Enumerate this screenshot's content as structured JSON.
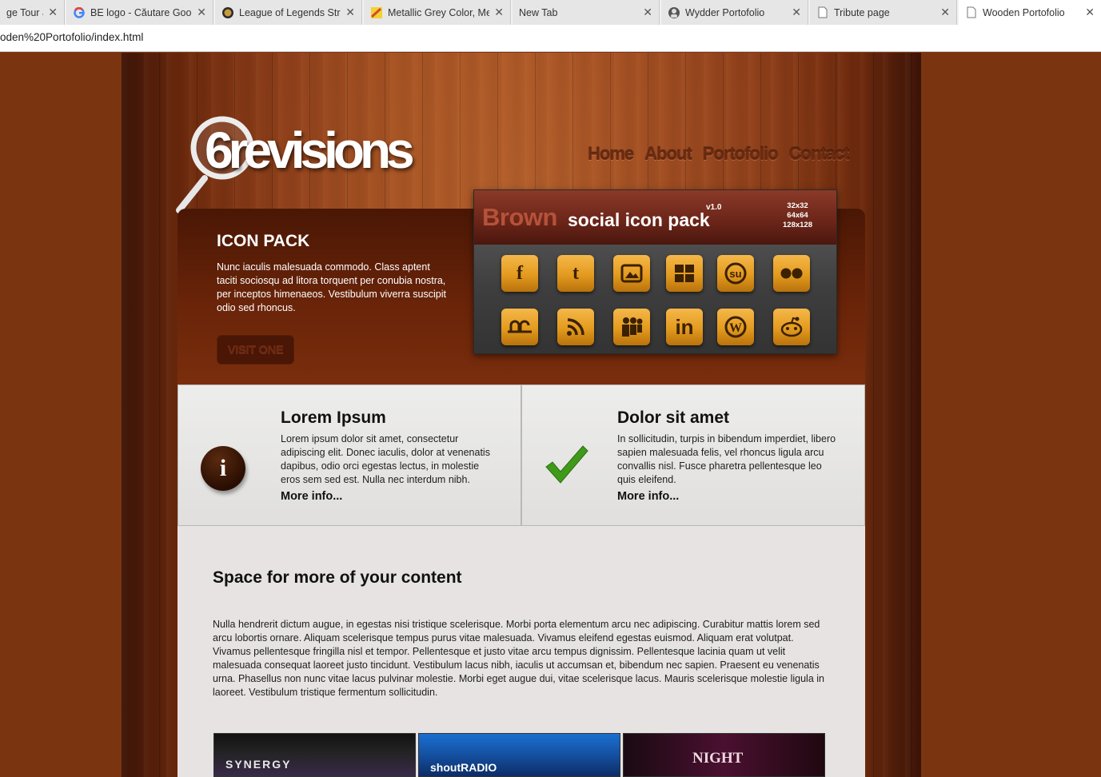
{
  "browser": {
    "tabs": [
      {
        "label": "ge Tour a",
        "icon": "page-icon",
        "active": false
      },
      {
        "label": "BE logo - Căutare Goog",
        "icon": "google-icon",
        "active": false
      },
      {
        "label": "League of Legends Stra",
        "icon": "lol-icon",
        "active": false
      },
      {
        "label": "Metallic Grey Color, Me",
        "icon": "color-swatch-icon",
        "active": false
      },
      {
        "label": "New Tab",
        "icon": "",
        "active": false
      },
      {
        "label": "Wydder Portofolio",
        "icon": "avatar-icon",
        "active": false
      },
      {
        "label": "Tribute page",
        "icon": "page-icon",
        "active": false
      },
      {
        "label": "Wooden Portofolio",
        "icon": "page-icon",
        "active": true
      }
    ],
    "close_glyph": "✕",
    "url": "oden%20Portofolio/index.html"
  },
  "site": {
    "logo_text": "6revisions",
    "nav": [
      "Home",
      "About",
      "Portofolio",
      "Contact"
    ],
    "hero": {
      "title": "ICON PACK",
      "text": "Nunc iaculis malesuada commodo. Class aptent taciti sociosqu ad litora torquent per conubia nostra, per inceptos himenaeos. Vestibulum viverra suscipit odio sed rhoncus.",
      "button": "VISIT ONE"
    },
    "pack_image": {
      "brown": "Brown",
      "title": "social icon pack",
      "version": "v1.0",
      "sizes": [
        "32x32",
        "64x64",
        "128x128"
      ],
      "icons": [
        "facebook-icon",
        "twitter-icon",
        "blogger-icon",
        "windows-icon",
        "stumbleupon-icon",
        "flickr-icon",
        "deviantart-icon",
        "rss-icon",
        "myspace-icon",
        "linkedin-icon",
        "wordpress-icon",
        "reddit-icon"
      ]
    },
    "features": [
      {
        "title": "Lorem Ipsum",
        "text": "Lorem ipsum dolor sit amet, consectetur adipiscing elit. Donec iaculis, dolor at venenatis dapibus, odio orci egestas lectus, in molestie eros sem sed est. Nulla nec interdum nibh.",
        "more": "More info...",
        "icon": "info-icon"
      },
      {
        "title": "Dolor sit amet",
        "text": "In sollicitudin, turpis in bibendum imperdiet, libero sapien malesuada felis, vel rhoncus ligula arcu convallis nisl. Fusce pharetra pellentesque leo quis eleifend.",
        "more": "More info...",
        "icon": "checkmark-icon"
      }
    ],
    "content": {
      "title": "Space for more of your content",
      "text": "Nulla hendrerit dictum augue, in egestas nisi tristique scelerisque. Morbi porta elementum arcu nec adipiscing. Curabitur mattis lorem sed arcu lobortis ornare. Aliquam scelerisque tempus purus vitae malesuada. Vivamus eleifend egestas euismod. Aliquam erat volutpat. Vivamus pellentesque fringilla nisl et tempor. Pellentesque et justo vitae arcu tempus dignissim. Pellentesque lacinia quam ut velit malesuada consequat laoreet justo tincidunt. Vestibulum lacus nibh, iaculis ut accumsan et, bibendum nec sapien. Praesent eu venenatis urna. Phasellus non nunc vitae lacus pulvinar molestie. Morbi eget augue dui, vitae scelerisque lacus. Mauris scelerisque molestie ligula in laoreet. Vestibulum tristique fermentum sollicitudin."
    },
    "thumbnails": [
      {
        "label": "SYNERGY"
      },
      {
        "label": "shoutRADIO"
      },
      {
        "label": "NIGHT"
      }
    ]
  },
  "colors": {
    "page_bg": "#7a3510",
    "hero_bg": "#5a1e07",
    "pack_orange": "#e39a1e",
    "content_bg": "#e6e3e2",
    "check_green": "#3f9a1a"
  }
}
